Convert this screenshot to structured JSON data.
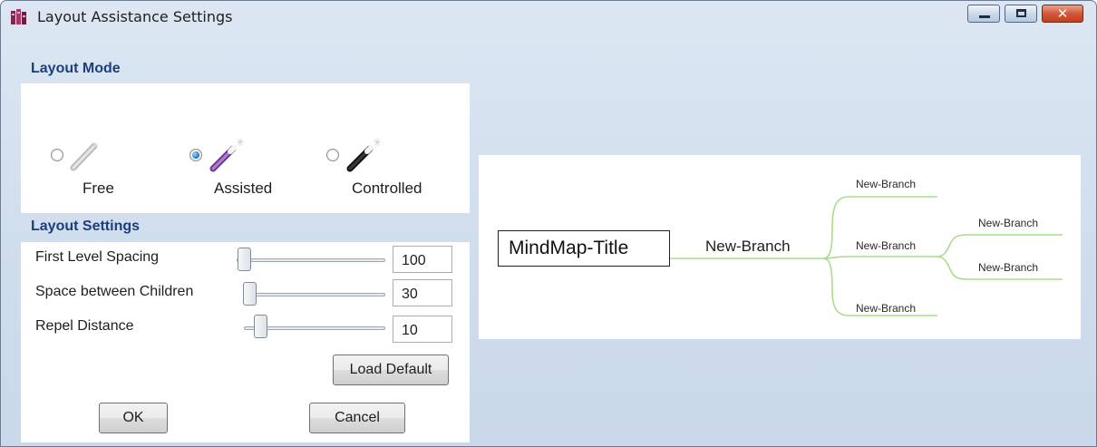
{
  "window": {
    "title": "Layout Assistance Settings",
    "close_glyph": "✕"
  },
  "layout_mode": {
    "header": "Layout Mode",
    "options": [
      {
        "label": "Free",
        "selected": false,
        "icon": "pencil-gray-icon"
      },
      {
        "label": "Assisted",
        "selected": true,
        "icon": "magic-wand-purple-icon"
      },
      {
        "label": "Controlled",
        "selected": false,
        "icon": "magic-wand-black-icon"
      }
    ]
  },
  "layout_settings": {
    "header": "Layout Settings",
    "first_level_spacing": {
      "label": "First Level Spacing",
      "value": "100"
    },
    "space_between_children": {
      "label": "Space between Children",
      "value": "30"
    },
    "repel_distance": {
      "label": "Repel Distance",
      "value": "10"
    },
    "load_default_label": "Load Default"
  },
  "footer": {
    "ok_label": "OK",
    "cancel_label": "Cancel"
  },
  "preview": {
    "title": "MindMap-Title",
    "branch_main": "New-Branch",
    "branch_top": "New-Branch",
    "branch_middle": "New-Branch",
    "branch_bottom": "New-Branch",
    "branch_sub_top": "New-Branch",
    "branch_sub_bottom": "New-Branch",
    "line_color": "#a8dd8a"
  },
  "colors": {
    "header_text": "#1c3f7c",
    "window_bg": "#d5e1ee"
  }
}
